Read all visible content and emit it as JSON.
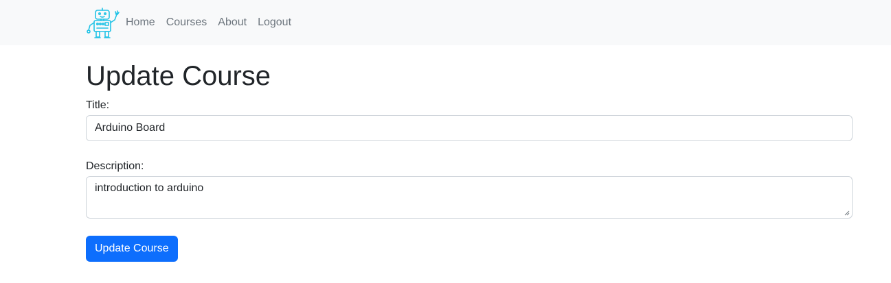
{
  "nav": {
    "logo": "robot-logo",
    "links": [
      {
        "label": "Home"
      },
      {
        "label": "Courses"
      },
      {
        "label": "About"
      },
      {
        "label": "Logout"
      }
    ]
  },
  "page": {
    "title": "Update Course"
  },
  "form": {
    "title_label": "Title:",
    "title_value": "Arduino Board",
    "description_label": "Description:",
    "description_value": "introduction to arduino",
    "submit_label": "Update Course"
  },
  "colors": {
    "navbar_bg": "#f8f9fa",
    "nav_link": "#6c757d",
    "primary": "#0d6efd",
    "logo": "#22c3e6"
  }
}
